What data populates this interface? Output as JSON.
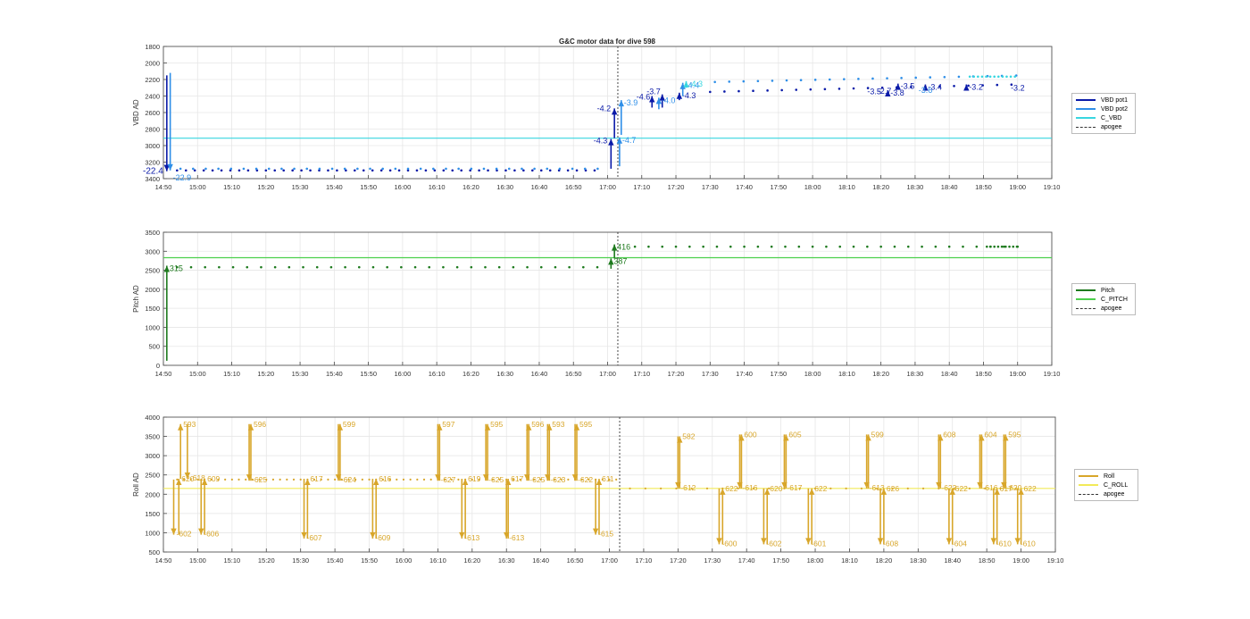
{
  "title": "G&C motor data for dive 598",
  "x_ticks": [
    "14:50",
    "15:00",
    "15:10",
    "15:20",
    "15:30",
    "15:40",
    "15:50",
    "16:00",
    "16:10",
    "16:20",
    "16:30",
    "16:40",
    "16:50",
    "17:00",
    "17:10",
    "17:20",
    "17:30",
    "17:40",
    "17:50",
    "18:00",
    "18:10",
    "18:20",
    "18:30",
    "18:40",
    "18:50",
    "19:00",
    "19:10"
  ],
  "colors": {
    "vbd_pot1": "#0a1aa8",
    "vbd_pot2": "#2f8fe8",
    "c_vbd": "#38d6e0",
    "pitch": "#1e7a1e",
    "c_pitch": "#4cd04c",
    "roll": "#d8a62a",
    "c_roll": "#f2ea58",
    "apogee": "#333333"
  },
  "chart_data": [
    {
      "type": "scatter",
      "title": "G&C motor data for dive 598",
      "ylabel": "VBD AD",
      "ylim": [
        3400,
        1800
      ],
      "y_reversed": true,
      "yticks": [
        1800,
        2000,
        2200,
        2400,
        2600,
        2800,
        3000,
        3200,
        3400
      ],
      "xlim_minutes": [
        0,
        260
      ],
      "apogee_minute": 133,
      "grid": true,
      "legend_position": "right",
      "legend": [
        "VBD pot1",
        "VBD pot2",
        "C_VBD",
        "apogee"
      ],
      "reference_line": {
        "name": "C_VBD",
        "y": 2910
      },
      "series": [
        {
          "name": "VBD pot1",
          "baseline_before": 3300,
          "baseline_after_start": 2350,
          "baseline_after_end": 2260
        },
        {
          "name": "VBD pot2",
          "baseline_before": 3290,
          "baseline_after_start": 2230,
          "baseline_after_end": 2150
        }
      ],
      "moves": [
        {
          "minute": 1,
          "from": 2150,
          "to": 3310,
          "label": "-22.4",
          "color": "pot1"
        },
        {
          "minute": 2,
          "from": 2120,
          "to": 3300,
          "label": "-22.9",
          "color": "pot2"
        },
        {
          "minute": 131,
          "from": 3280,
          "to": 2920,
          "label": "-4.3",
          "color": "pot1"
        },
        {
          "minute": 132,
          "from": 2910,
          "to": 2550,
          "label": "-4.2",
          "color": "pot1"
        },
        {
          "minute": 133.5,
          "from": 3250,
          "to": 2900,
          "label": "-4.7",
          "color": "pot2"
        },
        {
          "minute": 134,
          "from": 2870,
          "to": 2450,
          "label": "-3.9",
          "color": "pot2"
        },
        {
          "minute": 143,
          "from": 2540,
          "to": 2400,
          "label": "-4.6",
          "color": "pot1"
        },
        {
          "minute": 146,
          "from": 2540,
          "to": 2380,
          "label": "-3.7",
          "color": "pot1"
        },
        {
          "minute": 145,
          "from": 2560,
          "to": 2420,
          "label": "-4.0",
          "color": "pot2"
        },
        {
          "minute": 151,
          "from": 2450,
          "to": 2360,
          "label": "-4.3",
          "color": "pot1"
        },
        {
          "minute": 152,
          "from": 2400,
          "to": 2240,
          "label": "-4.4",
          "color": "pot2"
        },
        {
          "minute": 153,
          "from": 2300,
          "to": 2220,
          "label": "-4.3",
          "color": "c"
        },
        {
          "minute": 212,
          "from": 2360,
          "to": 2330,
          "label": "-3.8",
          "color": "pot1"
        },
        {
          "minute": 215,
          "from": 2320,
          "to": 2250,
          "label": "-3.5",
          "color": "pot1"
        },
        {
          "minute": 223,
          "from": 2320,
          "to": 2260,
          "label": "-3.4",
          "color": "pot1"
        },
        {
          "minute": 235,
          "from": 2300,
          "to": 2260,
          "label": "-3.2",
          "color": "pot1"
        }
      ],
      "extra_labels": [
        {
          "minute": 206,
          "y": 2345,
          "label": "-3.5",
          "color": "pot1"
        },
        {
          "minute": 209,
          "y": 2340,
          "label": "-2.7",
          "color": "pot1"
        },
        {
          "minute": 221,
          "y": 2330,
          "label": "-3.6",
          "color": "pot2"
        },
        {
          "minute": 248,
          "y": 2300,
          "label": "-3.2",
          "color": "pot1"
        }
      ]
    },
    {
      "type": "scatter",
      "ylabel": "Pitch AD",
      "ylim": [
        0,
        3500
      ],
      "yticks": [
        0,
        500,
        1000,
        1500,
        2000,
        2500,
        3000,
        3500
      ],
      "xlim_minutes": [
        0,
        260
      ],
      "apogee_minute": 133,
      "grid": true,
      "legend_position": "right",
      "legend": [
        "Pitch",
        "C_PITCH",
        "apogee"
      ],
      "reference_line": {
        "name": "C_PITCH",
        "y": 2830
      },
      "series": [
        {
          "name": "Pitch",
          "baseline_before": 2580,
          "baseline_after": 3120
        }
      ],
      "moves": [
        {
          "minute": 1,
          "from": 120,
          "to": 2620,
          "label": "315"
        },
        {
          "minute": 131,
          "from": 2540,
          "to": 2810,
          "label": "387"
        },
        {
          "minute": 132,
          "from": 2810,
          "to": 3180,
          "label": "416"
        }
      ]
    },
    {
      "type": "scatter",
      "ylabel": "Roll AD",
      "ylim": [
        500,
        4000
      ],
      "yticks": [
        500,
        1000,
        1500,
        2000,
        2500,
        3000,
        3500,
        4000
      ],
      "xlim_minutes": [
        0,
        260
      ],
      "apogee_minute": 133,
      "grid": true,
      "legend_position": "right",
      "legend": [
        "Roll",
        "C_ROLL",
        "apogee"
      ],
      "reference_line": {
        "name": "C_ROLL",
        "y": 2150
      },
      "series": [
        {
          "name": "Roll",
          "baseline_before": 2380,
          "baseline_after": 2150
        }
      ],
      "moves": [
        {
          "minute": 3,
          "from": 2380,
          "to": 950,
          "label": "-602"
        },
        {
          "minute": 4.5,
          "from": 950,
          "to": 2400,
          "label": "620"
        },
        {
          "minute": 5,
          "from": 2400,
          "to": 3820,
          "label": "593"
        },
        {
          "minute": 7,
          "from": 3820,
          "to": 2400,
          "label": "-618"
        },
        {
          "minute": 11,
          "from": 2400,
          "to": 950,
          "label": "-606"
        },
        {
          "minute": 12,
          "from": 950,
          "to": 2400,
          "label": "609"
        },
        {
          "minute": 25,
          "from": 3820,
          "to": 2350,
          "label": "-625"
        },
        {
          "minute": 25.5,
          "from": 2350,
          "to": 3820,
          "label": "596"
        },
        {
          "minute": 41,
          "from": 2400,
          "to": 850,
          "label": "-607"
        },
        {
          "minute": 42,
          "from": 850,
          "to": 2400,
          "label": "617"
        },
        {
          "minute": 51,
          "from": 3820,
          "to": 2350,
          "label": "-624"
        },
        {
          "minute": 51.5,
          "from": 2350,
          "to": 3820,
          "label": "599"
        },
        {
          "minute": 61,
          "from": 2400,
          "to": 850,
          "label": "-609"
        },
        {
          "minute": 62,
          "from": 850,
          "to": 2400,
          "label": "616"
        },
        {
          "minute": 80,
          "from": 3820,
          "to": 2350,
          "label": "-627"
        },
        {
          "minute": 80.5,
          "from": 2350,
          "to": 3820,
          "label": "597"
        },
        {
          "minute": 87,
          "from": 2400,
          "to": 850,
          "label": "-613"
        },
        {
          "minute": 88,
          "from": 850,
          "to": 2400,
          "label": "619"
        },
        {
          "minute": 94,
          "from": 3820,
          "to": 2350,
          "label": "-625"
        },
        {
          "minute": 94.5,
          "from": 2350,
          "to": 3820,
          "label": "595"
        },
        {
          "minute": 100,
          "from": 2400,
          "to": 850,
          "label": "-613"
        },
        {
          "minute": 100.5,
          "from": 850,
          "to": 2400,
          "label": "617"
        },
        {
          "minute": 106,
          "from": 3820,
          "to": 2350,
          "label": "-625"
        },
        {
          "minute": 106.5,
          "from": 2350,
          "to": 3820,
          "label": "596"
        },
        {
          "minute": 112,
          "from": 3820,
          "to": 2350,
          "label": "-623"
        },
        {
          "minute": 112.5,
          "from": 2350,
          "to": 3820,
          "label": "593"
        },
        {
          "minute": 120,
          "from": 3820,
          "to": 2350,
          "label": "-622"
        },
        {
          "minute": 120.5,
          "from": 2350,
          "to": 3820,
          "label": "595"
        },
        {
          "minute": 126,
          "from": 2400,
          "to": 950,
          "label": "-615"
        },
        {
          "minute": 127,
          "from": 950,
          "to": 2400,
          "label": "611"
        },
        {
          "minute": 150,
          "from": 3500,
          "to": 2150,
          "label": "-612"
        },
        {
          "minute": 150.5,
          "from": 2150,
          "to": 3500,
          "label": "582"
        },
        {
          "minute": 162,
          "from": 2150,
          "to": 700,
          "label": "-600"
        },
        {
          "minute": 163,
          "from": 700,
          "to": 2150,
          "label": "622"
        },
        {
          "minute": 168,
          "from": 3550,
          "to": 2150,
          "label": "-616"
        },
        {
          "minute": 168.5,
          "from": 2150,
          "to": 3550,
          "label": "600"
        },
        {
          "minute": 175,
          "from": 2150,
          "to": 700,
          "label": "-602"
        },
        {
          "minute": 176,
          "from": 700,
          "to": 2150,
          "label": "620"
        },
        {
          "minute": 181,
          "from": 3550,
          "to": 2150,
          "label": "-617"
        },
        {
          "minute": 181.5,
          "from": 2150,
          "to": 3550,
          "label": "605"
        },
        {
          "minute": 188,
          "from": 2150,
          "to": 700,
          "label": "-601"
        },
        {
          "minute": 189,
          "from": 700,
          "to": 2150,
          "label": "622"
        },
        {
          "minute": 205,
          "from": 3550,
          "to": 2150,
          "label": "-613"
        },
        {
          "minute": 205.5,
          "from": 2150,
          "to": 3550,
          "label": "599"
        },
        {
          "minute": 209,
          "from": 2150,
          "to": 700,
          "label": "-608"
        },
        {
          "minute": 210,
          "from": 700,
          "to": 2150,
          "label": "626"
        },
        {
          "minute": 226,
          "from": 3550,
          "to": 2150,
          "label": "-622"
        },
        {
          "minute": 226.5,
          "from": 2150,
          "to": 3550,
          "label": "608"
        },
        {
          "minute": 229,
          "from": 2150,
          "to": 700,
          "label": "-604"
        },
        {
          "minute": 230,
          "from": 700,
          "to": 2150,
          "label": "622"
        },
        {
          "minute": 238,
          "from": 3550,
          "to": 2150,
          "label": "-616"
        },
        {
          "minute": 238.5,
          "from": 2150,
          "to": 3550,
          "label": "604"
        },
        {
          "minute": 242,
          "from": 2150,
          "to": 700,
          "label": "-610"
        },
        {
          "minute": 243,
          "from": 700,
          "to": 2150,
          "label": "617"
        },
        {
          "minute": 245,
          "from": 3550,
          "to": 2150,
          "label": "-620"
        },
        {
          "minute": 245.5,
          "from": 2150,
          "to": 3550,
          "label": "595"
        },
        {
          "minute": 249,
          "from": 2150,
          "to": 700,
          "label": "-610"
        },
        {
          "minute": 250,
          "from": 700,
          "to": 2150,
          "label": "622"
        }
      ]
    }
  ]
}
